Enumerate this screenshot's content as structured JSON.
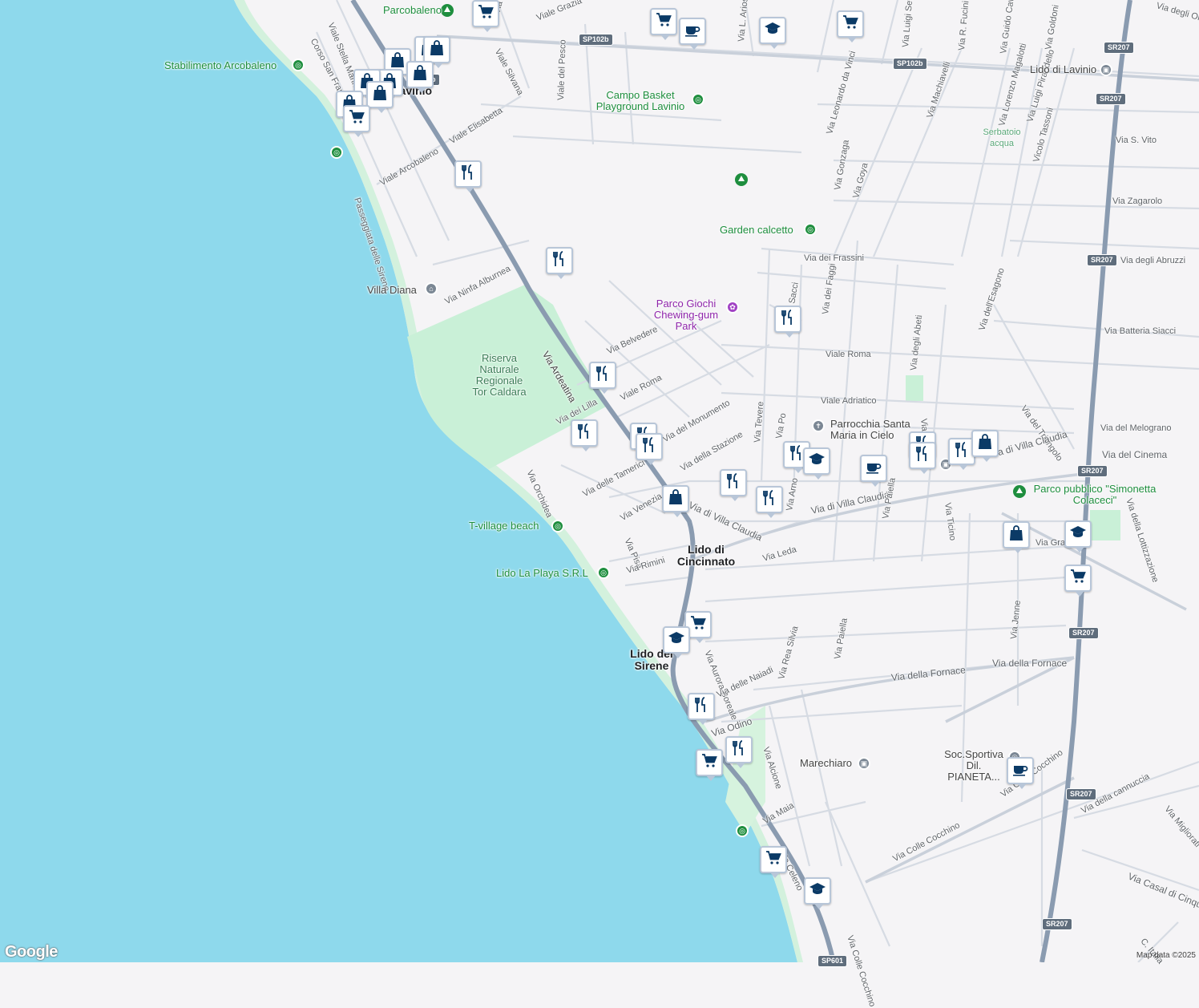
{
  "map": {
    "attribution": "Map data ©2025",
    "logo": "Google"
  },
  "colors": {
    "sea": "#8ed9ec",
    "land": "#f5f4f6",
    "park": "#c9f0d7",
    "main_road": "#8a9bb0",
    "road": "#d6dbe3",
    "pin_icon": "#0b3a66"
  },
  "towns": {
    "lavinio": "Lavinio",
    "cincinnato": "Lido di Cincinnato",
    "sirene": "Lido dei Sirene"
  },
  "reserve": "Riserva Naturale Regionale Tor Caldara",
  "serbatoio": "Serbatoio acqua",
  "poi": {
    "parcobaleno": "Parcobaleno",
    "arcobaleno": "Stabilimento Arcobaleno",
    "campo_basket": "Campo Basket Playground Lavinio",
    "garden": "Garden calcetto",
    "villa_diana": "Villa Diana",
    "parco_giochi": "Parco Giochi Chewing-gum Park",
    "parrocchia": "Parrocchia Santa Maria in Cielo",
    "t_village": "T-village beach",
    "lido_playa": "Lido La Playa S.R.L",
    "parco_pubblico": "Parco pubblico \"Simonetta Colaceci\"",
    "marechiaro": "Marechiaro",
    "soc_sportiva": "Soc.Sportiva Dil. PIANETA...",
    "lido_lavinio_station": "Lido di Lavinio"
  },
  "shields": [
    "SP102b",
    "SP102b",
    "SR207",
    "SR207",
    "SR207",
    "SR207",
    "SR207",
    "SR207",
    "SR207",
    "SP601"
  ],
  "roads": [
    "Viale Stella Marina",
    "Corso San Francesco",
    "Viale Elisabetta",
    "Viale Arcobaleno",
    "Passeggiata delle Sirene",
    "Via Ninfa Alburnea",
    "Viale Silvana",
    "Viale del Pesco",
    "Viale Grazia",
    "Via L. Ariosto",
    "Via Luigi Settembrini",
    "Via R. Fucini",
    "Via Guido Cavalcanti",
    "Via Goldoni",
    "Via Leonardo da Vinci",
    "Via Machiavelli",
    "Via Gonzaga",
    "Via Goya",
    "Via Lorenzo Magalotti",
    "Via Luigi Pirandello",
    "Vicolo Tassoni",
    "Via S. Vito",
    "Via Zagarolo",
    "Via degli Abruzzi",
    "Via dei Frassini",
    "Via dei Faggi",
    "Via Ardeatina",
    "Via Belvedere",
    "Viale Roma",
    "Viale Roma",
    "Viale Adriatico",
    "Via degli Abeti",
    "Via dell'Esagono",
    "Via Batteria Siacci",
    "Via del Triangolo",
    "Via del Melograno",
    "Via del Cinema",
    "Via della Lottizzazione",
    "Via dei Lilla",
    "Via del Monumento",
    "Via della Stazione",
    "Via Tevere",
    "Via Po",
    "Via Arno",
    "Via di Villa Claudia",
    "Via di Villa Claudia",
    "Via di Villa Claudia",
    "Via delle Tamerici",
    "Via Venezia",
    "Via Orchidea",
    "Via Pisa",
    "Via Rimini",
    "Via Leda",
    "Via Paiella",
    "Via Ticino",
    "Via Grazie",
    "Via Aurora Boreale",
    "Via Rea Silvia",
    "Via Paiella",
    "Via della Fornace",
    "Via della Fornace",
    "Via Jenne",
    "Via delle Naiadi",
    "Via Odino",
    "Via Alcione",
    "Via Maia",
    "Via Celeno",
    "Via Colle Cocchino",
    "Via Colle Cocchino",
    "Via Colle Cocchino",
    "Via della cannuccia",
    "Via Migliorati",
    "Via Casal di Cinque",
    "C. Italia",
    "Via degli Olmi",
    "Via Piave",
    "Via Sacci",
    "Via dei Gigli"
  ],
  "pins": [
    {
      "type": "cart",
      "name": "grocery-pin"
    },
    {
      "type": "cart",
      "name": "grocery-pin"
    },
    {
      "type": "cafe",
      "name": "cafe-pin"
    },
    {
      "type": "school",
      "name": "school-pin"
    },
    {
      "type": "cart",
      "name": "grocery-pin"
    },
    {
      "type": "bag",
      "name": "shopping-pin"
    },
    {
      "type": "bag",
      "name": "shopping-pin"
    },
    {
      "type": "bag",
      "name": "shopping-pin"
    },
    {
      "type": "bag",
      "name": "shopping-pin"
    },
    {
      "type": "bag",
      "name": "shopping-pin"
    },
    {
      "type": "bag",
      "name": "shopping-pin"
    },
    {
      "type": "bag",
      "name": "shopping-pin"
    },
    {
      "type": "bag",
      "name": "shopping-pin"
    },
    {
      "type": "cart",
      "name": "grocery-pin"
    },
    {
      "type": "food",
      "name": "restaurant-pin"
    },
    {
      "type": "food",
      "name": "restaurant-pin"
    },
    {
      "type": "food",
      "name": "restaurant-pin"
    },
    {
      "type": "food",
      "name": "restaurant-pin"
    },
    {
      "type": "food",
      "name": "restaurant-pin"
    },
    {
      "type": "food",
      "name": "restaurant-pin"
    },
    {
      "type": "food",
      "name": "restaurant-pin"
    },
    {
      "type": "bag",
      "name": "shopping-pin"
    },
    {
      "type": "food",
      "name": "restaurant-pin"
    },
    {
      "type": "food",
      "name": "restaurant-pin"
    },
    {
      "type": "food",
      "name": "restaurant-pin"
    },
    {
      "type": "food",
      "name": "restaurant-pin"
    },
    {
      "type": "school",
      "name": "school-pin"
    },
    {
      "type": "cafe",
      "name": "cafe-pin"
    },
    {
      "type": "food",
      "name": "restaurant-pin"
    },
    {
      "type": "food",
      "name": "restaurant-pin"
    },
    {
      "type": "bag",
      "name": "shopping-pin"
    },
    {
      "type": "bag",
      "name": "shopping-pin"
    },
    {
      "type": "school",
      "name": "school-pin"
    },
    {
      "type": "cart",
      "name": "grocery-pin"
    },
    {
      "type": "cart",
      "name": "grocery-pin"
    },
    {
      "type": "school",
      "name": "school-pin"
    },
    {
      "type": "food",
      "name": "restaurant-pin"
    },
    {
      "type": "cart",
      "name": "grocery-pin"
    },
    {
      "type": "food",
      "name": "restaurant-pin"
    },
    {
      "type": "cafe",
      "name": "cafe-pin"
    },
    {
      "type": "cart",
      "name": "grocery-pin"
    },
    {
      "type": "school",
      "name": "school-pin"
    },
    {
      "type": "school",
      "name": "school-pin"
    }
  ]
}
